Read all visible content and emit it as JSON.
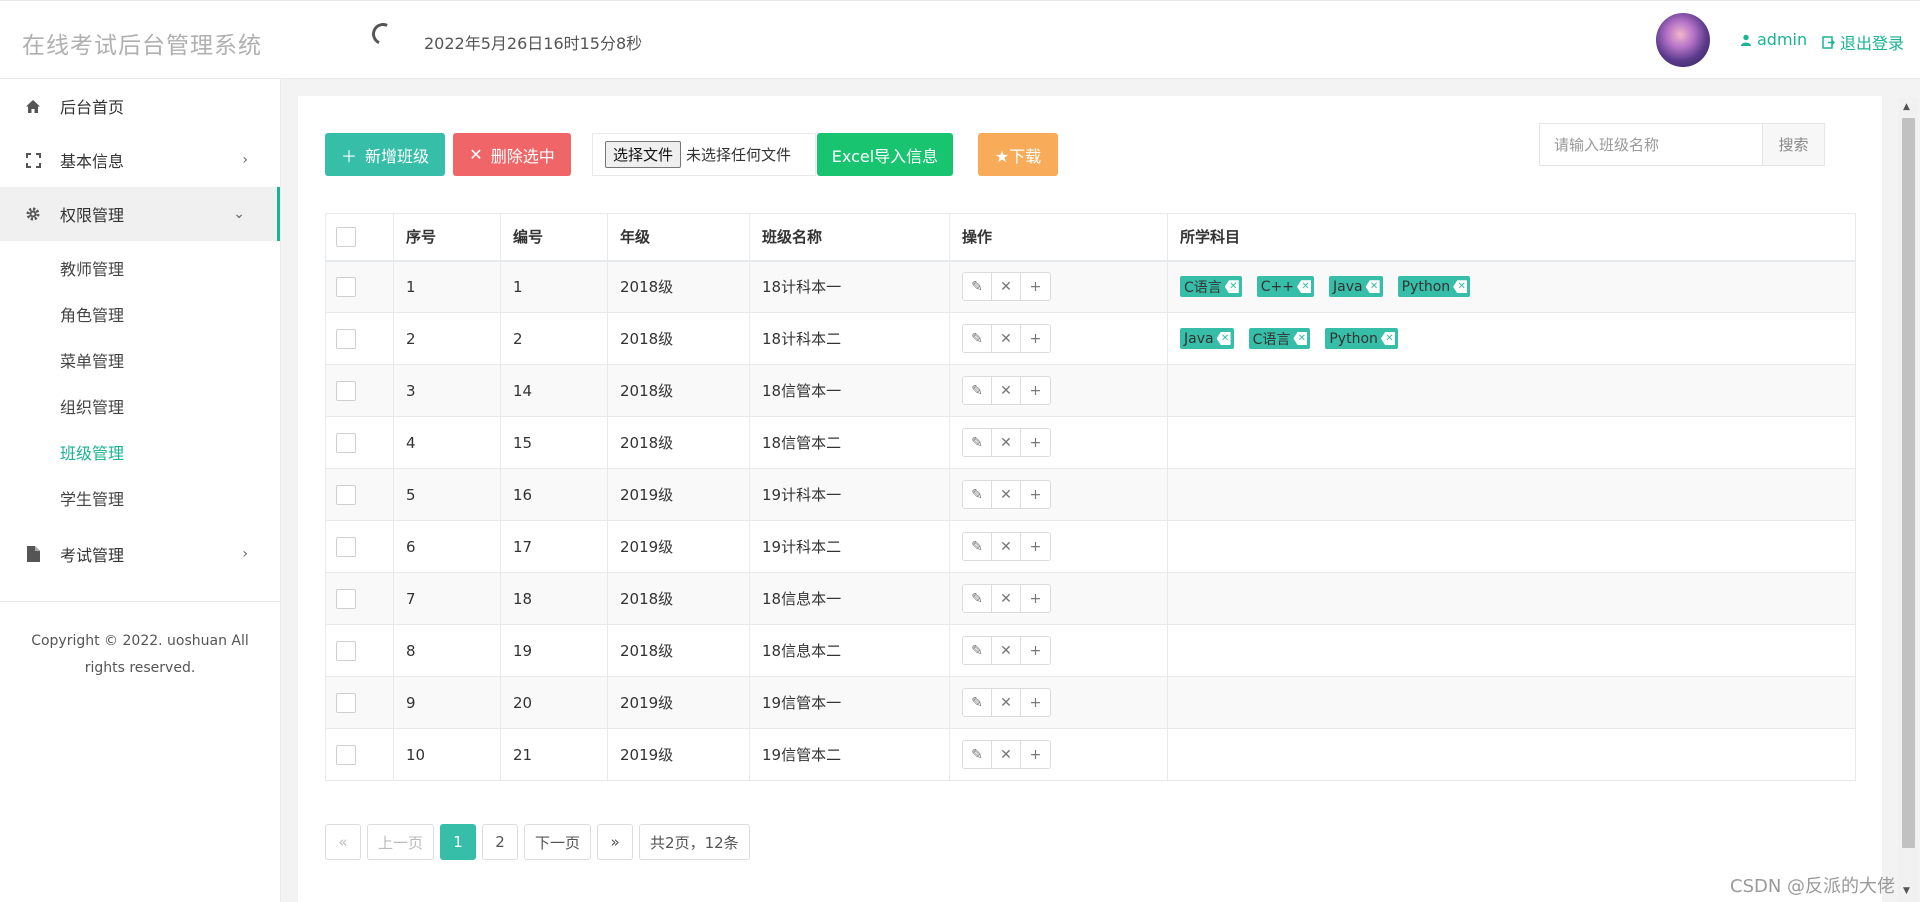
{
  "header": {
    "logo": "在线考试后台管理系统",
    "clock": "2022年5月26日16时15分8秒",
    "user": "admin",
    "logout": "退出登录"
  },
  "sidebar": {
    "items": [
      {
        "label": "后台首页",
        "icon": "home-icon"
      },
      {
        "label": "基本信息",
        "icon": "expand-icon"
      },
      {
        "label": "权限管理",
        "icon": "gear-icon"
      }
    ],
    "sub_items": [
      {
        "label": "教师管理"
      },
      {
        "label": "角色管理"
      },
      {
        "label": "菜单管理"
      },
      {
        "label": "组织管理"
      },
      {
        "label": "班级管理"
      },
      {
        "label": "学生管理"
      }
    ],
    "exam": {
      "label": "考试管理",
      "icon": "file-icon"
    },
    "copyright": "Copyright © 2022. uoshuan All rights reserved."
  },
  "toolbar": {
    "add": "新增班级",
    "delete": "删除选中",
    "file_button": "选择文件",
    "file_status": "未选择任何文件",
    "excel": "Excel导入信息",
    "download": "下载",
    "search_placeholder": "请输入班级名称",
    "search": "搜索"
  },
  "table": {
    "headers": [
      "序号",
      "编号",
      "年级",
      "班级名称",
      "操作",
      "所学科目"
    ],
    "rows": [
      {
        "seq": "1",
        "id": "1",
        "grade": "2018级",
        "name": "18计科本一",
        "subjects": [
          "C语言",
          "C++",
          "Java",
          "Python"
        ]
      },
      {
        "seq": "2",
        "id": "2",
        "grade": "2018级",
        "name": "18计科本二",
        "subjects": [
          "Java",
          "C语言",
          "Python"
        ]
      },
      {
        "seq": "3",
        "id": "14",
        "grade": "2018级",
        "name": "18信管本一",
        "subjects": []
      },
      {
        "seq": "4",
        "id": "15",
        "grade": "2018级",
        "name": "18信管本二",
        "subjects": []
      },
      {
        "seq": "5",
        "id": "16",
        "grade": "2019级",
        "name": "19计科本一",
        "subjects": []
      },
      {
        "seq": "6",
        "id": "17",
        "grade": "2019级",
        "name": "19计科本二",
        "subjects": []
      },
      {
        "seq": "7",
        "id": "18",
        "grade": "2018级",
        "name": "18信息本一",
        "subjects": []
      },
      {
        "seq": "8",
        "id": "19",
        "grade": "2018级",
        "name": "18信息本二",
        "subjects": []
      },
      {
        "seq": "9",
        "id": "20",
        "grade": "2019级",
        "name": "19信管本一",
        "subjects": []
      },
      {
        "seq": "10",
        "id": "21",
        "grade": "2019级",
        "name": "19信管本二",
        "subjects": []
      }
    ]
  },
  "pager": {
    "first": "«",
    "prev": "上一页",
    "pages": [
      "1",
      "2"
    ],
    "next": "下一页",
    "last": "»",
    "summary": "共2页，12条"
  },
  "watermark": "CSDN @反派的大佬",
  "colors": {
    "accent": "#1ab394",
    "tag": "#37bea8",
    "danger": "#f06567",
    "excel": "#18c46f",
    "download": "#f8ac59"
  }
}
